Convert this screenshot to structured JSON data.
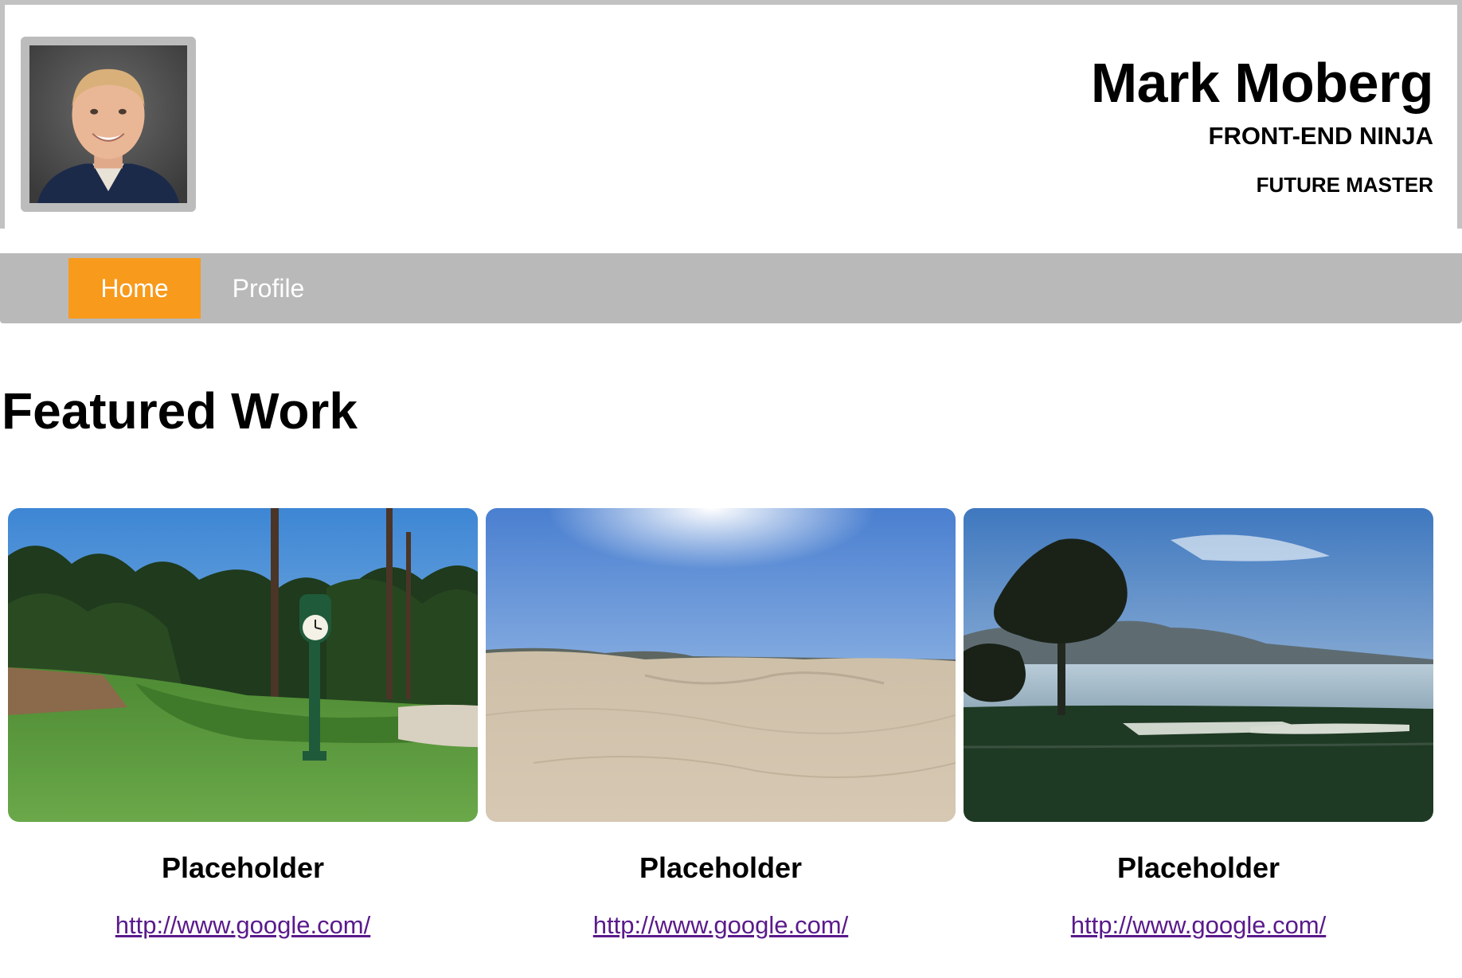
{
  "header": {
    "name": "Mark Moberg",
    "title": "FRONT-END NINJA",
    "subtitle": "FUTURE MASTER"
  },
  "nav": {
    "items": [
      {
        "label": "Home",
        "active": true
      },
      {
        "label": "Profile",
        "active": false
      }
    ],
    "active_color": "#f89a1c",
    "bar_color": "#b9b9b9"
  },
  "featured": {
    "heading": "Featured Work",
    "items": [
      {
        "caption": "Placeholder",
        "link": "http://www.google.com/",
        "image": "golf-course-clock-photo"
      },
      {
        "caption": "Placeholder",
        "link": "http://www.google.com/",
        "image": "sand-dunes-photo"
      },
      {
        "caption": "Placeholder",
        "link": "http://www.google.com/",
        "image": "coastal-cypress-tree-photo"
      }
    ]
  }
}
